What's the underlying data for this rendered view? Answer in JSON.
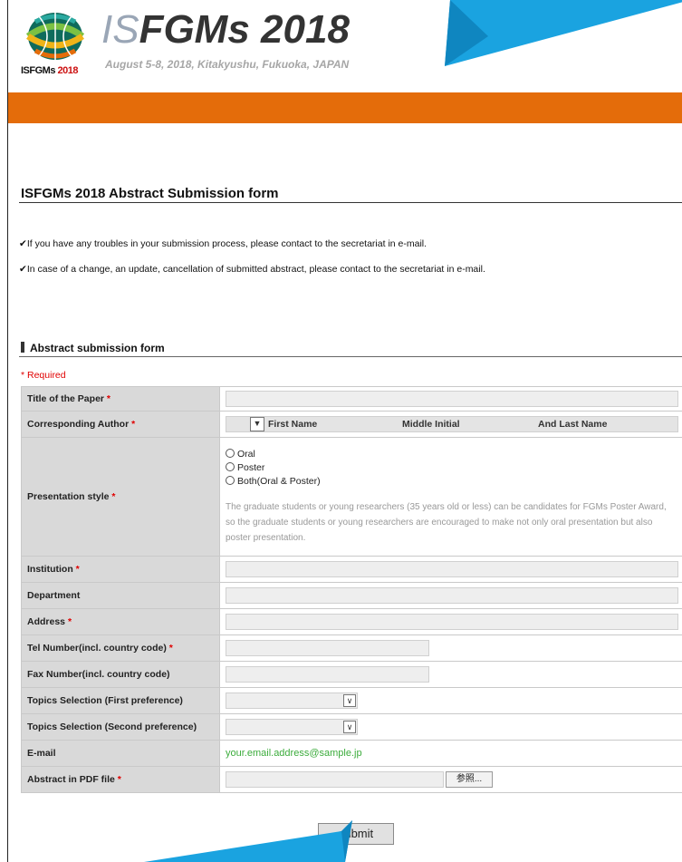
{
  "header": {
    "logo_text_black": "ISFGMs",
    "logo_text_red": "2018",
    "title_prefix": "IS",
    "title_rest": "FGMs 2018",
    "subtitle": "August 5-8, 2018, Kitakyushu, Fukuoka, JAPAN"
  },
  "colors": {
    "orange_bar": "#e46c0a",
    "required": "#e00000",
    "email": "#3cac3c"
  },
  "page": {
    "section_title": "ISFGMs 2018 Abstract Submission form",
    "notes": [
      "If you have any troubles in your submission process, please contact to the secretariat in e-mail.",
      "In case of a change, an update, cancellation of submitted abstract, please contact to the secretariat in e-mail."
    ],
    "check_mark": "✔",
    "form_heading": "Abstract submission form",
    "required_note": "* Required"
  },
  "form": {
    "title_label": "Title of the Paper",
    "author_label": "Corresponding Author",
    "author_first": "First Name",
    "author_middle": "Middle Initial",
    "author_last": "And Last Name",
    "presentation_label": "Presentation style",
    "options": [
      "Oral",
      "Poster",
      "Both(Oral & Poster)"
    ],
    "presentation_note": "The graduate students or young researchers (35 years old or less) can be candidates for FGMs Poster Award, so the graduate students or young researchers are encouraged to make not only oral presentation but also poster presentation.",
    "institution_label": "Institution",
    "department_label": "Department",
    "address_label": "Address",
    "tel_label": "Tel Number(incl. country code)",
    "fax_label": "Fax Number(incl. country code)",
    "topic1_label": "Topics Selection (First preference)",
    "topic2_label": "Topics Selection (Second preference)",
    "email_label": "E-mail",
    "email_value": "your.email.address@sample.jp",
    "pdf_label": "Abstract in PDF file",
    "browse_label": "参照...",
    "req_mark": "*",
    "submit_label": "submit"
  }
}
